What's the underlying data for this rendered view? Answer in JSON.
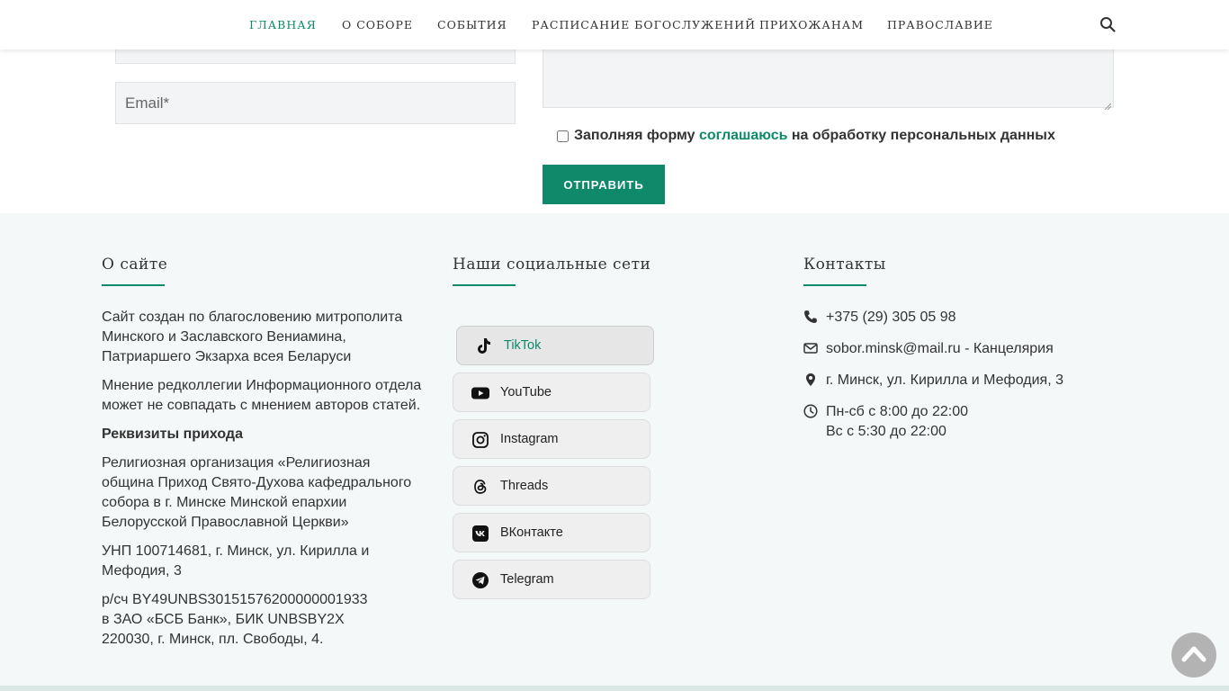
{
  "nav": {
    "items": [
      "ГЛАВНАЯ",
      "О СОБОРЕ",
      "СОБЫТИЯ",
      "РАСПИСАНИЕ БОГОСЛУЖЕНИЙ",
      "ПРИХОЖАНАМ",
      "ПРАВОСЛАВИЕ"
    ],
    "active": "ГЛАВНАЯ",
    "search_icon": "search-icon"
  },
  "form": {
    "email_placeholder": "Email*",
    "consent_prefix": "Заполняя форму ",
    "consent_link": "соглашаюсь",
    "consent_suffix": " на обработку персональных данных",
    "submit_label": "ОТПРАВИТЬ"
  },
  "footer": {
    "about": {
      "title": "О сайте",
      "p1": "Сайт создан по благословению митрополита Минского и Заславского Вениамина, Патриаршего Экзарха всея Беларуси",
      "p2": "Мнение редколлегии Информационного отдела может не совпадать с мнением авторов статей.",
      "requisites_title": "Реквизиты прихода",
      "p3": "Религиозная организация «Религиозная община Приход Свято-Духова кафедрального собора в г. Минске Минской епархии Белорусской Православной Церкви»",
      "p4": "УНП 100714681, г. Минск, ул. Кирилла и Мефодия, 3",
      "p5_line1": "р/сч BY49UNBS30151576200000001933",
      "p5_line2": "в ЗАО «БСБ Банк», БИК UNBSBY2X",
      "p5_line3": "220030, г. Минск, пл. Свободы, 4."
    },
    "social": {
      "title": "Наши социальные сети",
      "items": [
        {
          "label": "TikTok",
          "icon": "tiktok-icon"
        },
        {
          "label": "YouTube",
          "icon": "youtube-icon"
        },
        {
          "label": "Instagram",
          "icon": "instagram-icon"
        },
        {
          "label": "Threads",
          "icon": "threads-icon"
        },
        {
          "label": "ВКонтакте",
          "icon": "vk-icon"
        },
        {
          "label": "Telegram",
          "icon": "telegram-icon"
        }
      ]
    },
    "contacts": {
      "title": "Контакты",
      "phone": "+375 (29) 305 05 98",
      "email": "sobor.minsk@mail.ru - Канцелярия",
      "address": "г. Минск, ул. Кирилла и Мефодия, 3",
      "hours_line1": "Пн-сб с 8:00 до 22:00",
      "hours_line2": "Вс с 5:30 до 22:00"
    }
  },
  "colors": {
    "accent": "#0e8a6a",
    "footer_bg": "#f4f8f8"
  }
}
